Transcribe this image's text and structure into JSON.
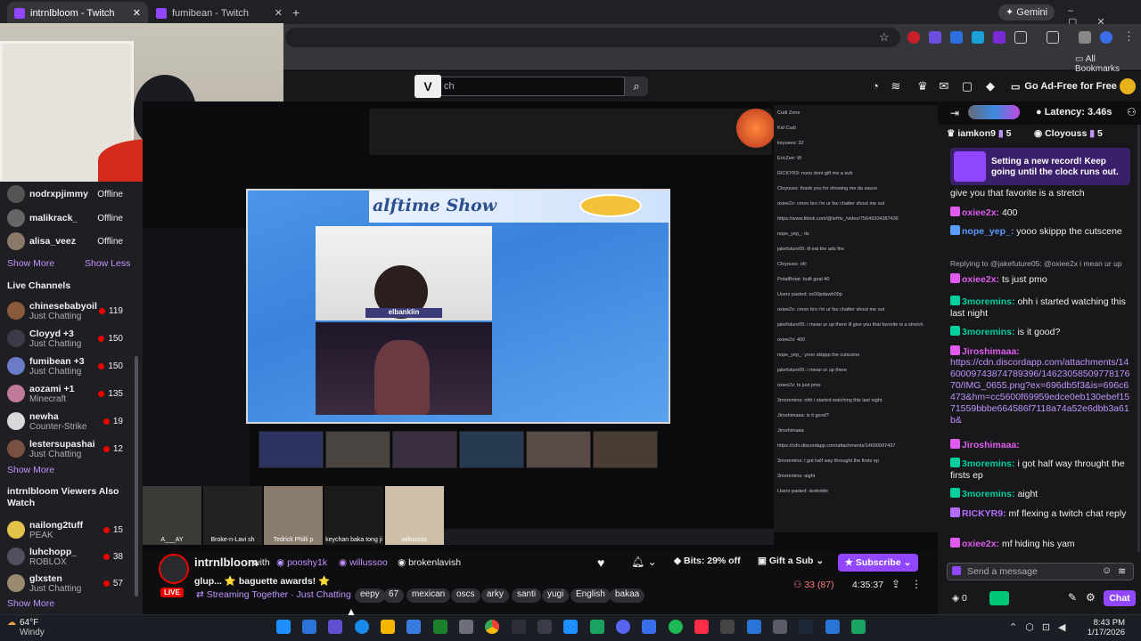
{
  "browser": {
    "tabs": [
      {
        "title": "intrnlbloom - Twitch",
        "active": true
      },
      {
        "title": "fumibean - Twitch",
        "active": false
      }
    ],
    "gemini_label": "Gemini",
    "bookmarks_label": "All Bookmarks"
  },
  "twitch_nav": {
    "search_placeholder": "ch",
    "ad_free_label": "Go Ad-Free for Free"
  },
  "sidebar": {
    "offline_channels": [
      {
        "name": "nodrxpjimmy",
        "status": "Offline"
      },
      {
        "name": "malikrack_",
        "status": "Offline"
      },
      {
        "name": "alisa_veez",
        "status": "Offline"
      }
    ],
    "show_more": "Show More",
    "show_less": "Show Less",
    "live_heading": "Live Channels",
    "live_channels": [
      {
        "name": "chinesebabyoil",
        "category": "Just Chatting",
        "viewers": "119",
        "color": "#8a5a3c"
      },
      {
        "name": "Cloyyd +3",
        "category": "Just Chatting",
        "viewers": "150",
        "color": "#3a3a48"
      },
      {
        "name": "fumibean +3",
        "category": "Just Chatting",
        "viewers": "150",
        "color": "#6a7cc8"
      },
      {
        "name": "aozami +1",
        "category": "Minecraft",
        "viewers": "135",
        "color": "#c07a9a"
      },
      {
        "name": "newha",
        "category": "Counter-Strike",
        "viewers": "19",
        "color": "#d8d8d8"
      },
      {
        "name": "lestersupashai",
        "category": "Just Chatting",
        "viewers": "12",
        "color": "#7a5040"
      }
    ],
    "show_more_2": "Show More",
    "viewers_heading": "intrnlbloom Viewers Also Watch",
    "also_watch": [
      {
        "name": "nailong2tuff",
        "category": "PEAK",
        "viewers": "15",
        "color": "#e3c24a"
      },
      {
        "name": "luhchopp_",
        "category": "ROBLOX",
        "viewers": "38",
        "color": "#505060"
      },
      {
        "name": "glxsten",
        "category": "Just Chatting",
        "viewers": "57",
        "color": "#9a8a70"
      }
    ],
    "show_more_3": "Show More"
  },
  "stream": {
    "game_title": "alftime Show",
    "cam_label": "elbanklin",
    "member_names": [
      "A___AY",
      "Broke-n-Lavi sh",
      "Tedrick Philli p",
      "keychan baka tong ji",
      "willussoo"
    ],
    "inner_chat_lines": [
      "Cudi Zone",
      "Kid Cudi",
      "keyuees: 32",
      "EricZee: W",
      "RICKYR9: nooo dont gift me a sub",
      "Cloyouss: thank you for showing me da sauce",
      "oxiee2x: cmon bro i'm ur fav chatter shout me out",
      "https://www.tiktok.com/@tefrtv_/video/75649204387436",
      "nope_yep_: its",
      "jakefuture05: ill eat the ads fire",
      "Cloyouss: ofc",
      "PotatBotat: built goal 40",
      "Users pasted: oc00pdawh00p",
      "oxiee2x: cmon bro i'm ur fav chatter shout me out",
      "jakefuture05: i mean ur up there ill give you that favorite is a stretch",
      "oxiee2x: 400",
      "nope_yep_: yooo skippp the cutscene",
      "jakefuture05: i mean ur up there",
      "oxiee2x: ts just pmo",
      "3moremins: ohh i started watching this last night",
      "Jiroshimaaa: is it good?",
      "Jiroshimaaa",
      "https://cdn.discordapp.com/attachments/14600097437",
      "3moremins: i got half way throught the firsts ep",
      "3moremins: aight",
      "Users pasted: durkobbr"
    ]
  },
  "stream_info": {
    "streamer": "intrnlbloom",
    "with_label": "with",
    "collab": [
      "pooshy1k",
      "willussoo",
      "brokenlavish"
    ],
    "title": "glup... ⭐ baguette awards! ⭐",
    "live_label": "LIVE",
    "category": "Streaming Together",
    "subcategory": "Just Chatting",
    "tags": [
      "eepy",
      "67",
      "mexican",
      "oscs",
      "arky",
      "santi",
      "yugi",
      "English",
      "bakaa"
    ],
    "bits_label": "Bits: 29% off",
    "gift_label": "Gift a Sub",
    "subscribe_label": "Subscribe",
    "viewers": "33 (87)",
    "uptime": "4:35:37"
  },
  "chat": {
    "latency": "Latency: 3.46s",
    "pinned": [
      {
        "name": "iamkon9",
        "count": "5"
      },
      {
        "name": "Cloyouss",
        "count": "5"
      }
    ],
    "record_text": "Setting a new record! Keep going until the clock runs out.",
    "messages": [
      {
        "user": "",
        "text": "give you that favorite is a stretch",
        "color": "#efeff1"
      },
      {
        "user": "oxiee2x:",
        "text": "400",
        "color": "#e05cf0"
      },
      {
        "user": "nope_yep_:",
        "text": "yooo skippp the cutscene",
        "color": "#5b9cff"
      },
      {
        "user": "",
        "text": "Replying to @jakefuture05: @oxiee2x i mean ur up",
        "color": "#adadb8"
      },
      {
        "user": "oxiee2x:",
        "text": "ts just pmo",
        "color": "#e05cf0"
      },
      {
        "user": "3moremins:",
        "text": "ohh i started watching this last night",
        "color": "#00d0a0"
      },
      {
        "user": "3moremins:",
        "text": "is it good?",
        "color": "#00d0a0"
      },
      {
        "user": "Jiroshimaaa:",
        "text": "",
        "color": "#e05cf0"
      },
      {
        "user": "",
        "text": "https://cdn.discordapp.com/attachments/1460009743874789396/1462305850977817670/IMG_0655.png?ex=696db5f3&is=696c6473&hm=cc5600f69959edce0eb130ebef1571559bbbe664586f7118a74a52e6dbb3a61b&",
        "color": "#bf94ff"
      },
      {
        "user": "Jiroshimaaa:",
        "text": "",
        "color": "#e05cf0"
      },
      {
        "user": "3moremins:",
        "text": "i got half way throught the firsts ep",
        "color": "#00d0a0"
      },
      {
        "user": "3moremins:",
        "text": "aight",
        "color": "#00d0a0"
      },
      {
        "user": "RICKYR9:",
        "text": "mf flexing a twitch chat reply",
        "color": "#b46cff"
      },
      {
        "user": "oxiee2x:",
        "text": "mf hiding his yam",
        "color": "#e05cf0"
      }
    ],
    "input_placeholder": "Send a message",
    "points": "0",
    "chat_button": "Chat"
  },
  "taskbar": {
    "weather_temp": "64°F",
    "weather_desc": "Windy",
    "time": "8:43 PM",
    "date": "1/17/2026"
  },
  "colors": {
    "twitch_purple": "#9147ff",
    "live_red": "#eb0400",
    "link_purple": "#bf94ff"
  }
}
